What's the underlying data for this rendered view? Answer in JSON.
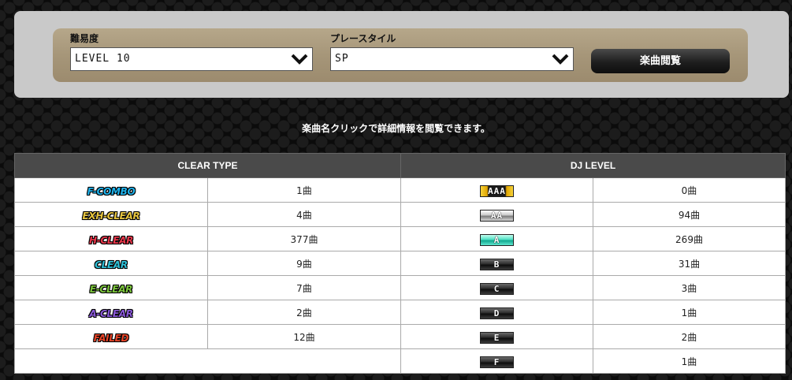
{
  "filters": {
    "difficulty": {
      "label": "難易度",
      "value": "LEVEL 10"
    },
    "play_style": {
      "label": "プレースタイル",
      "value": "SP"
    },
    "browse_button": "楽曲閲覧"
  },
  "hint": "楽曲名クリックで詳細情報を閲覧できます。",
  "clear_table": {
    "header": "CLEAR TYPE",
    "rows": [
      {
        "label": "F-COMBO",
        "count": "1曲",
        "color": "#1fb4ee"
      },
      {
        "label": "EXH-CLEAR",
        "count": "4曲",
        "color": "#e8c640"
      },
      {
        "label": "H-CLEAR",
        "count": "377曲",
        "color": "#e8364a"
      },
      {
        "label": "CLEAR",
        "count": "9曲",
        "color": "#2fc0d8"
      },
      {
        "label": "E-CLEAR",
        "count": "7曲",
        "color": "#7cc63c"
      },
      {
        "label": "A-CLEAR",
        "count": "2曲",
        "color": "#8a58d8"
      },
      {
        "label": "FAILED",
        "count": "12曲",
        "color": "#e84428"
      }
    ]
  },
  "dj_table": {
    "header": "DJ LEVEL",
    "rows": [
      {
        "grade": "AAA",
        "count": "0曲",
        "style": "gold"
      },
      {
        "grade": "AA",
        "count": "94曲",
        "style": "silver"
      },
      {
        "grade": "A",
        "count": "269曲",
        "style": "teal"
      },
      {
        "grade": "B",
        "count": "31曲",
        "style": "dark"
      },
      {
        "grade": "C",
        "count": "3曲",
        "style": "dark"
      },
      {
        "grade": "D",
        "count": "1曲",
        "style": "dark"
      },
      {
        "grade": "E",
        "count": "2曲",
        "style": "dark"
      },
      {
        "grade": "F",
        "count": "1曲",
        "style": "dark"
      }
    ]
  }
}
